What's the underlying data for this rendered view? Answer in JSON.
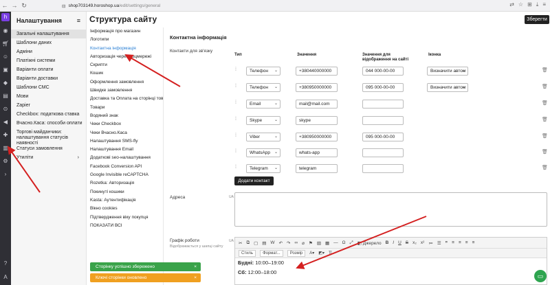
{
  "browser": {
    "url_host": "shop703149.horoshop.ua",
    "url_path": "/edit/settings/general"
  },
  "sidebar": {
    "title": "Налаштування",
    "items": [
      {
        "label": "Загальні налаштування",
        "active": true
      },
      {
        "label": "Шаблони даних"
      },
      {
        "label": "Адміни"
      },
      {
        "label": "Платіжні системи"
      },
      {
        "label": "Варіанти оплати"
      },
      {
        "label": "Варіанти доставки"
      },
      {
        "label": "Шаблони СМС"
      },
      {
        "label": "Мови"
      },
      {
        "label": "Zapier"
      },
      {
        "label": "Checkbox: податкова ставка"
      },
      {
        "label": "Вчасно.Каса: способи оплати"
      },
      {
        "label": "Торгові майданчики: налаштування статусів наявності"
      },
      {
        "label": "Статуси замовлення"
      },
      {
        "label": "Утиліти"
      }
    ]
  },
  "page": {
    "title": "Структура сайту",
    "save_label": "Зберегти"
  },
  "menu": {
    "items": [
      "Інформація про магазин",
      "Логотипи",
      "Контактна інформація",
      "Авторизація через соцмережі",
      "Скрипти",
      "Кошик",
      "Оформлення замовлення",
      "Швидке замовлення",
      "Доставка та Оплата на сторінці товару",
      "Товари",
      "Водяний знак",
      "Чеки Checkbox",
      "Чеки Вчасно.Каса",
      "Налаштування SMS-fly",
      "Налаштування Email",
      "Додаткові seo-налаштування",
      "Facebook Conversion API",
      "Google Invisible reCAPTCHA",
      "Rozetka: Авторизація",
      "Покинуті кошики",
      "Kasta: Аутентифікація",
      "Вікно cookies",
      "Підтвердження віку покупця",
      "ПОКАЗАТИ ВСІ"
    ],
    "active_index": 2
  },
  "contacts": {
    "section_title": "Контактна інформація",
    "label": "Контакти для зв'язку",
    "headers": {
      "type": "Тип",
      "value": "Значення",
      "site_value": "Значення для відображення на сайті",
      "icon": "Іконка"
    },
    "rows": [
      {
        "type": "Телефон",
        "value": "+380440000000",
        "site_value": "044 000-00-00",
        "icon": "Визначити автом"
      },
      {
        "type": "Телефон",
        "value": "+380950000000",
        "site_value": "095 000-00-00",
        "icon": "Визначити автом"
      },
      {
        "type": "Email",
        "value": "mail@mail.com",
        "site_value": "",
        "icon": ""
      },
      {
        "type": "Skype",
        "value": "skype",
        "site_value": "",
        "icon": ""
      },
      {
        "type": "Viber",
        "value": "+380950000000",
        "site_value": "095 000-00-00",
        "icon": ""
      },
      {
        "type": "WhatsApp",
        "value": "whats-app",
        "site_value": "",
        "icon": ""
      },
      {
        "type": "Telegram",
        "value": "telegram",
        "site_value": "",
        "icon": ""
      }
    ],
    "add_label": "Додати контакт"
  },
  "address": {
    "label": "Адреса",
    "lang": "UA"
  },
  "schedule": {
    "label": "Графік роботи",
    "sub_label": "Відображається у шапці сайту",
    "lang": "UA",
    "toolbar_source": "Джерело",
    "toolbar_style": "Стиль",
    "toolbar_format": "Формат...",
    "toolbar_size": "Розмір",
    "lines": [
      {
        "day": "Будні:",
        "hours": "10:00–19:00"
      },
      {
        "day": "Сб:",
        "hours": "12:00–18:00"
      }
    ]
  },
  "toasts": {
    "success": "Сторінку успішно збережено",
    "warning": "Ключі сторінки оновлено"
  }
}
